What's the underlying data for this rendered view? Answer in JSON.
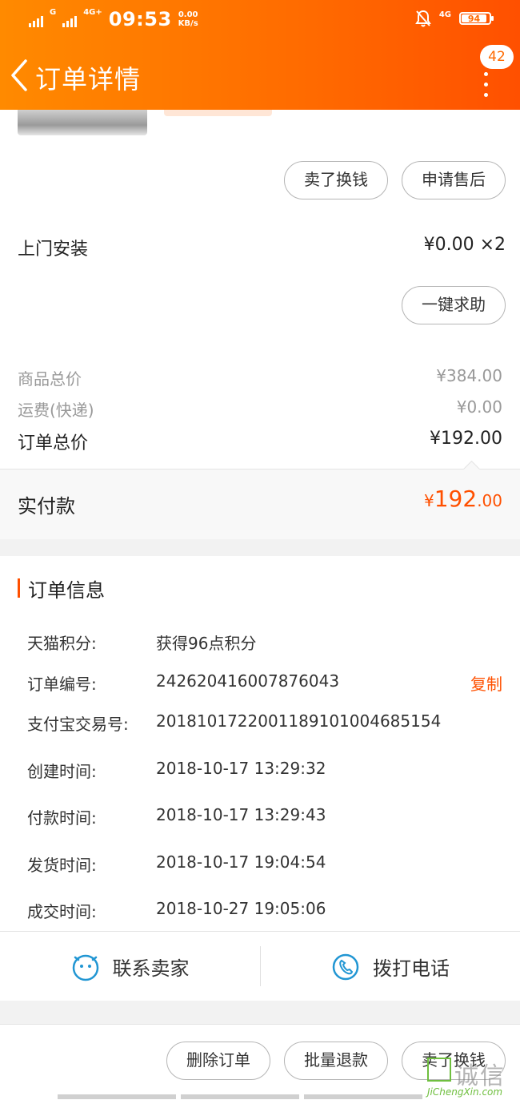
{
  "status_bar": {
    "net_small": "G",
    "net_4g": "4G+",
    "time": "09:53",
    "speed_value": "0.00",
    "speed_unit": "KB/s",
    "right_net": "4G",
    "battery": "94"
  },
  "header": {
    "title": "订单详情",
    "badge_count": "42"
  },
  "item": {
    "buttons": [
      "卖了换钱",
      "申请售后"
    ]
  },
  "install": {
    "label": "上门安装",
    "price": "¥0.00 ×2",
    "help_button": "一键求助"
  },
  "summary": {
    "goods_total_label": "商品总价",
    "goods_total_value": "¥384.00",
    "shipping_label": "运费(快递)",
    "shipping_value": "¥0.00",
    "order_total_label": "订单总价",
    "order_total_value": "¥192.00",
    "paid_label": "实付款",
    "paid_currency": "¥",
    "paid_integer": "192",
    "paid_decimal": ".00"
  },
  "order_info": {
    "title": "订单信息",
    "rows": [
      {
        "label": "天猫积分:",
        "value": "获得96点积分"
      },
      {
        "label": "订单编号:",
        "value": "242620416007876043"
      },
      {
        "label": "支付宝交易号:",
        "value": "2018101722001189101004685154"
      },
      {
        "label": "创建时间:",
        "value": "2018-10-17 13:29:32"
      },
      {
        "label": "付款时间:",
        "value": "2018-10-17 13:29:43"
      },
      {
        "label": "发货时间:",
        "value": "2018-10-17 19:04:54"
      },
      {
        "label": "成交时间:",
        "value": "2018-10-27 19:05:06"
      }
    ],
    "copy_label": "复制"
  },
  "contact": {
    "seller_label": "联系卖家",
    "phone_label": "拨打电话"
  },
  "bottom_bar": {
    "buttons": [
      "删除订单",
      "批量退款",
      "卖了换钱"
    ]
  },
  "watermark": {
    "text": "诚信",
    "url": "JiChengXin.com"
  },
  "colors": {
    "accent": "#ff5000",
    "header_start": "#ff8a00",
    "header_end": "#ff5000"
  }
}
